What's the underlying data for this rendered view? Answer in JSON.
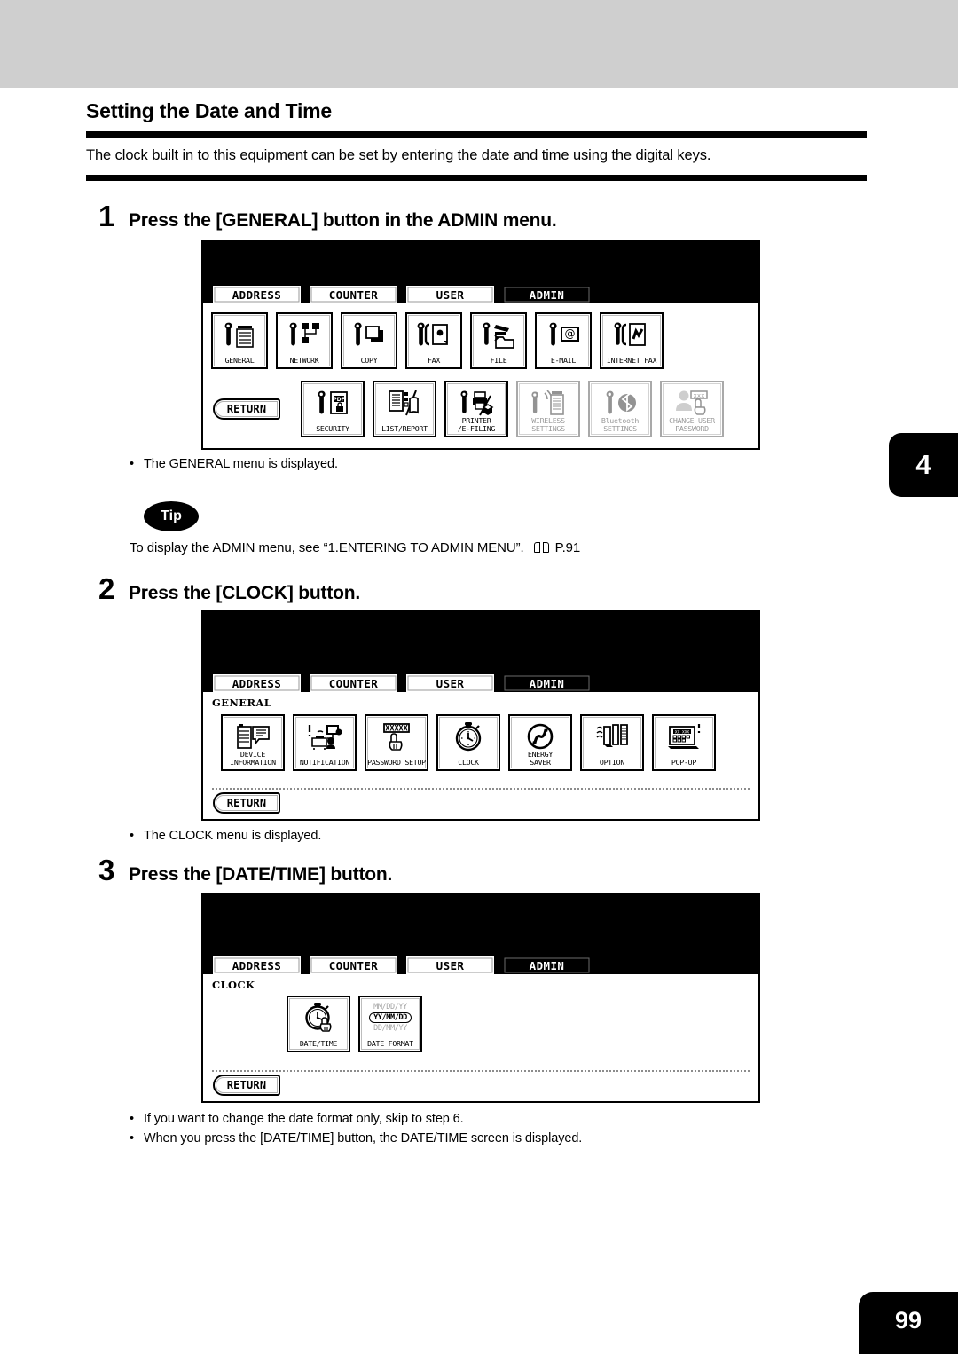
{
  "document": {
    "section_title": "Setting the Date and Time",
    "lead_text": "The clock built in to this equipment can be set by entering the date and time using the digital keys.",
    "chapter_tab": "4",
    "page_number": "99"
  },
  "steps": [
    {
      "num": "1",
      "text": "Press the [GENERAL] button in the ADMIN menu."
    },
    {
      "num": "2",
      "text": "Press the [CLOCK] button."
    },
    {
      "num": "3",
      "text": "Press the [DATE/TIME] button."
    }
  ],
  "notes": {
    "general_menu": "The GENERAL menu is displayed.",
    "clock_menu": "The CLOCK menu is displayed.",
    "skip_step": "If you want to change the date format only, skip to step 6.",
    "datetime_screen": "When you press the [DATE/TIME] button, the DATE/TIME screen is displayed."
  },
  "tip": {
    "badge": "Tip",
    "text_before": "To display the ADMIN menu, see “1.ENTERING TO ADMIN MENU”.",
    "page_ref": "P.91"
  },
  "tabs": {
    "address": "ADDRESS",
    "counter": "COUNTER",
    "user": "USER",
    "admin": "ADMIN"
  },
  "common": {
    "return_label": "RETURN"
  },
  "panel1": {
    "breadcrumb": "",
    "row1": [
      {
        "label": "GENERAL",
        "icon": "wrench-copier-icon",
        "dim": false
      },
      {
        "label": "NETWORK",
        "icon": "wrench-network-icon",
        "dim": false
      },
      {
        "label": "COPY",
        "icon": "wrench-copy-icon",
        "dim": false
      },
      {
        "label": "FAX",
        "icon": "wrench-fax-icon",
        "dim": false
      },
      {
        "label": "FILE",
        "icon": "wrench-file-icon",
        "dim": false
      },
      {
        "label": "E-MAIL",
        "icon": "wrench-email-icon",
        "dim": false
      },
      {
        "label": "INTERNET FAX",
        "icon": "wrench-ifax-icon",
        "dim": false
      }
    ],
    "row2": [
      {
        "label": "SECURITY",
        "icon": "wrench-pdf-lock-icon",
        "dim": false
      },
      {
        "label": "LIST/REPORT",
        "icon": "list-report-icon",
        "dim": false
      },
      {
        "label": "PRINTER\n/E-FILING",
        "icon": "wrench-printer-icon",
        "dim": false
      },
      {
        "label": "WIRELESS\nSETTINGS",
        "icon": "wrench-wireless-icon",
        "dim": true
      },
      {
        "label": "Bluetooth\nSETTINGS",
        "icon": "wrench-bluetooth-icon",
        "dim": true
      },
      {
        "label": "CHANGE USER\nPASSWORD",
        "icon": "change-password-icon",
        "dim": true
      }
    ]
  },
  "panel2": {
    "breadcrumb": "GENERAL",
    "icons": [
      {
        "label": "DEVICE\nINFORMATION",
        "icon": "device-information-icon"
      },
      {
        "label": "NOTIFICATION",
        "icon": "notification-icon"
      },
      {
        "label": "PASSWORD SETUP",
        "icon": "password-setup-icon"
      },
      {
        "label": "CLOCK",
        "icon": "stopwatch-icon"
      },
      {
        "label": "ENERGY\nSAVER",
        "icon": "energy-saver-icon"
      },
      {
        "label": "OPTION",
        "icon": "option-icon"
      },
      {
        "label": "POP-UP",
        "icon": "popup-icon"
      }
    ]
  },
  "panel3": {
    "breadcrumb": "CLOCK",
    "icons": [
      {
        "label": "DATE/TIME",
        "icon": "stopwatch-hand-icon"
      },
      {
        "label": "DATE FORMAT",
        "icon": "date-format-icon"
      }
    ],
    "date_formats": {
      "option1": "MM/DD/YY",
      "option2": "YY/MM/DD",
      "option3": "DD/MM/YY",
      "selected": "YY/MM/DD"
    }
  }
}
